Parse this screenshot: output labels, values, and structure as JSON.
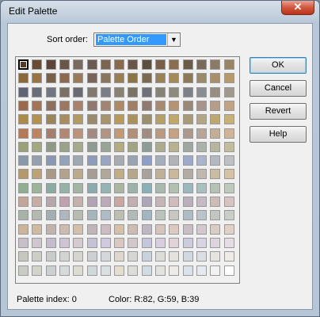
{
  "window": {
    "title": "Edit Palette",
    "close_glyph": "✕"
  },
  "sort": {
    "label": "Sort order:",
    "value": "Palette Order",
    "arrow_glyph": "▼"
  },
  "buttons": {
    "ok": "OK",
    "cancel": "Cancel",
    "revert": "Revert",
    "help": "Help"
  },
  "status": {
    "index_text": "Palette index:  0",
    "color_text": "Color:  R:82, G:59, B:39"
  },
  "palette": {
    "selected_index": 0,
    "columns": 16,
    "rows": [
      [
        "#523b27",
        "#6b4a32",
        "#5e4438",
        "#6a5648",
        "#7a6a5e",
        "#6a5a50",
        "#7a6650",
        "#8a6a4a",
        "#6a5648",
        "#5a5040",
        "#7a5e46",
        "#8a6e50",
        "#6a5a48",
        "#7a6a58",
        "#8a7a66",
        "#9a8466"
      ],
      [
        "#8a6a3a",
        "#9a7440",
        "#7a6248",
        "#8a6a50",
        "#9a7a5a",
        "#7a6658",
        "#8a765e",
        "#9a7e52",
        "#8a7448",
        "#7a6a52",
        "#9a8256",
        "#a48a58",
        "#8a7a5a",
        "#9a8a68",
        "#a8906a",
        "#b49a6c"
      ],
      [
        "#5e6472",
        "#6a6e7a",
        "#727680",
        "#7a7066",
        "#6a6a72",
        "#827a70",
        "#7a7e86",
        "#8a8270",
        "#7a7466",
        "#6e7278",
        "#868276",
        "#8e8a7e",
        "#7e8288",
        "#8a8e94",
        "#968e82",
        "#a09a8e"
      ],
      [
        "#9a6a4e",
        "#a47458",
        "#8e6e5e",
        "#9a7866",
        "#a8826a",
        "#92786c",
        "#a08474",
        "#b08a66",
        "#9e8068",
        "#8e7a70",
        "#a88a70",
        "#b49474",
        "#9a887a",
        "#a8948a",
        "#b49e8a",
        "#c0a488"
      ],
      [
        "#a88a4a",
        "#b4924e",
        "#9a8658",
        "#a68e60",
        "#b29a62",
        "#9a8a6a",
        "#a69470",
        "#ba9a58",
        "#aa9260",
        "#9a8e6e",
        "#b6a066",
        "#c0a86a",
        "#a69a78",
        "#b2a684",
        "#bca872",
        "#c8b07a"
      ],
      [
        "#b47a58",
        "#be8462",
        "#a67e6e",
        "#b08874",
        "#bc9278",
        "#a48a80",
        "#b09484",
        "#c49a74",
        "#b09078",
        "#a08c82",
        "#bc9a7e",
        "#c6a282",
        "#ac9a8e",
        "#b8a498",
        "#c4ae96",
        "#cfb498"
      ],
      [
        "#9aa078",
        "#a4a87e",
        "#8e9a86",
        "#9aa28a",
        "#a6aa8a",
        "#8e9a92",
        "#9aa496",
        "#b2ac7e",
        "#a2a484",
        "#8e9c98",
        "#aeaa8c",
        "#b8b290",
        "#9ea8a0",
        "#aab2aa",
        "#b6b6a0",
        "#c2bc9e"
      ],
      [
        "#8a98a8",
        "#94a0ae",
        "#8a98b4",
        "#96a2b8",
        "#a0a8b4",
        "#8e9cbc",
        "#9aa6c0",
        "#a8acb0",
        "#9aa4b0",
        "#8e9ec4",
        "#a4aebc",
        "#b0b4b8",
        "#9eaac8",
        "#aab4cc",
        "#b4b8c0",
        "#bec0c4"
      ],
      [
        "#b49a6a",
        "#bca274",
        "#a89a86",
        "#b2a48c",
        "#bcaa8a",
        "#a69e94",
        "#b0a89a",
        "#c2ac84",
        "#b6a68c",
        "#a8a29c",
        "#c0b096",
        "#cab89a",
        "#b4aca4",
        "#c0b8ae",
        "#cabca2",
        "#d4c2a4"
      ],
      [
        "#92ae92",
        "#9cb498",
        "#8aaca4",
        "#96b2a8",
        "#a2b6a2",
        "#8aacb0",
        "#96b4b4",
        "#aab6a0",
        "#9cb2aa",
        "#8ab0b8",
        "#a8baae",
        "#b2c0b2",
        "#9cb8bc",
        "#a8c0c0",
        "#b4c2b6",
        "#bec8bc"
      ],
      [
        "#c2a69a",
        "#c8aea2",
        "#b6a8aa",
        "#bea2b0",
        "#c6b0ac",
        "#b2a4b4",
        "#bcaab8",
        "#caa8a0",
        "#c0aeb0",
        "#aea6b8",
        "#c6b4b6",
        "#d0bcba",
        "#bab0bc",
        "#c6bac4",
        "#ccbcb8",
        "#d6c4c0"
      ],
      [
        "#a8b2a8",
        "#b2bab0",
        "#a2b0b4",
        "#aeb8bc",
        "#b6bcb2",
        "#a6b4bc",
        "#b0bcc4",
        "#bcc0b2",
        "#b2bab8",
        "#a2b6c0",
        "#bac2bc",
        "#c4c8c0",
        "#aebcc4",
        "#bac4cc",
        "#c2c6c0",
        "#cacec8"
      ],
      [
        "#cab49a",
        "#d0baa2",
        "#c2b4aa",
        "#ccbcb0",
        "#d4c0aa",
        "#c0b4b8",
        "#cabcc0",
        "#d6c0a6",
        "#ccbcb2",
        "#beb6c0",
        "#d4c4ba",
        "#dccac0",
        "#c8bec6",
        "#d2c8ce",
        "#d8ccc4",
        "#e0d2c8"
      ],
      [
        "#c8c0c8",
        "#d0c6ce",
        "#c4bccc",
        "#cec4d4",
        "#d4cad0",
        "#c6c2d6",
        "#d0cadc",
        "#dac8c0",
        "#d2c8cc",
        "#c4c6dc",
        "#d8cede",
        "#e0d4d8",
        "#ccccdc",
        "#d8d4e4",
        "#dcd6dc",
        "#e4dee4"
      ],
      [
        "#c6c8c0",
        "#cecec6",
        "#c8cccc",
        "#d2d4d2",
        "#d6d6ce",
        "#cad0d4",
        "#d4d8da",
        "#ded8cc",
        "#d6d6d2",
        "#cad2dc",
        "#dcdcd8",
        "#e4e2dc",
        "#d2d8e0",
        "#dcdee6",
        "#e6e4e0",
        "#eeeae6"
      ],
      [
        "#c8ccc4",
        "#d2d4cc",
        "#ccd0d0",
        "#d6dada",
        "#dcdcd2",
        "#d0d8dc",
        "#dadfe2",
        "#e4decf",
        "#dcdcd8",
        "#d2dae2",
        "#e2e2de",
        "#ecebe6",
        "#dce2ea",
        "#e6eaf0",
        "#f2f2f2",
        "#ffffff"
      ]
    ]
  }
}
